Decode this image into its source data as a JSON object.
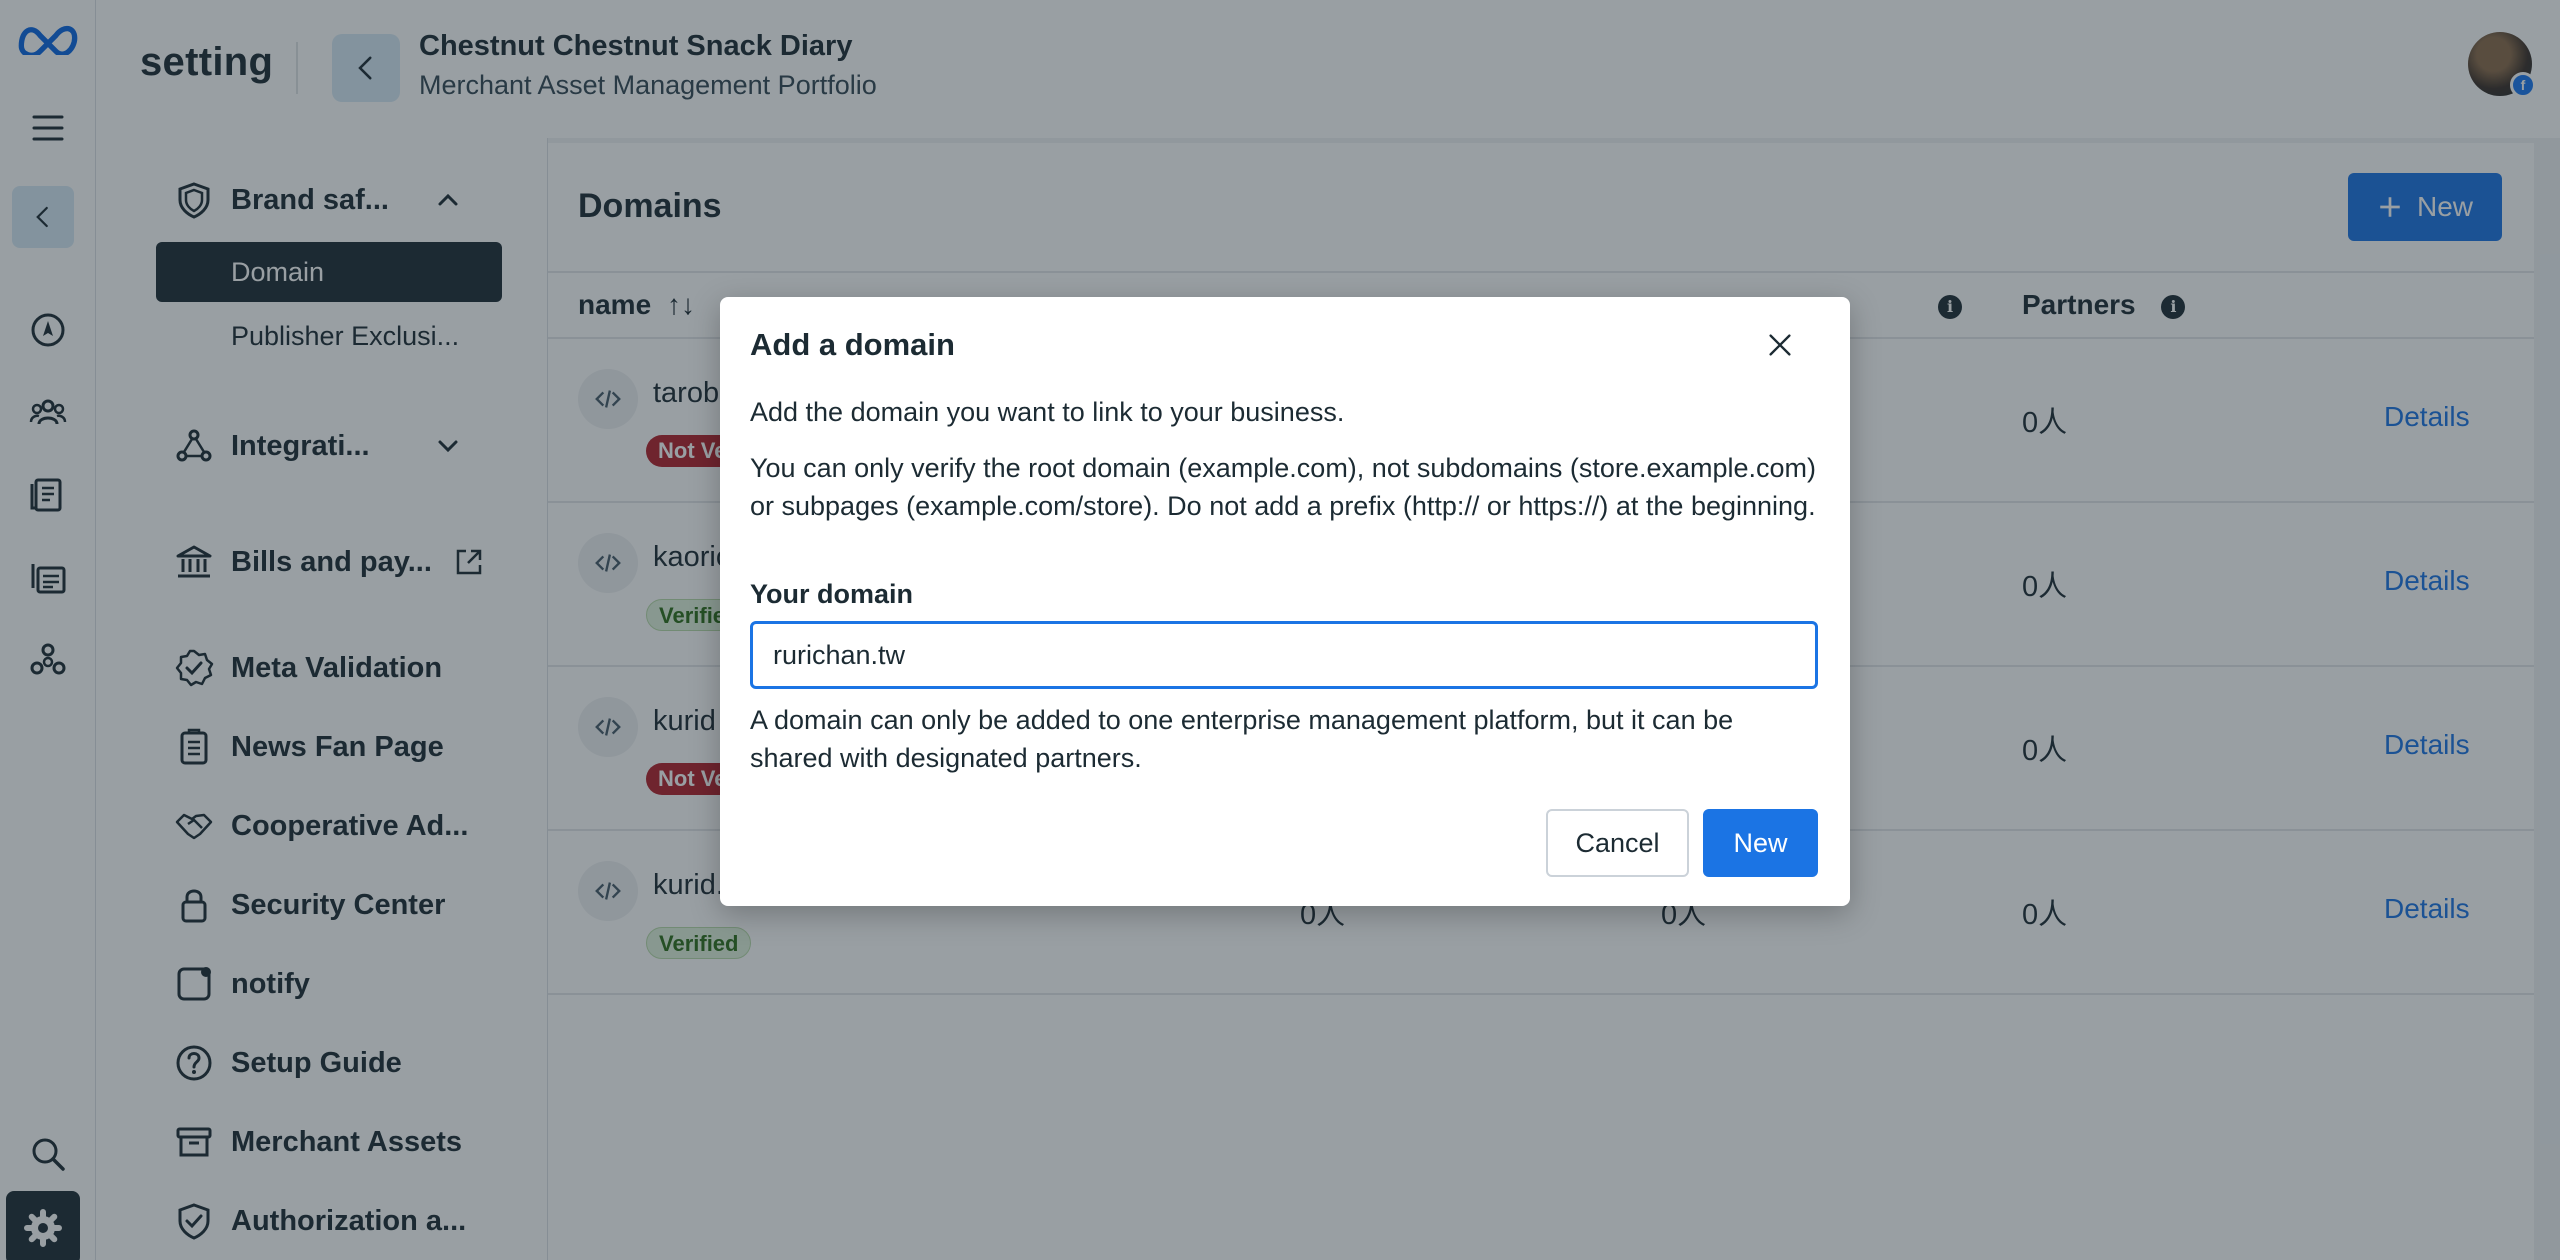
{
  "header": {
    "app_title": "setting",
    "business_name": "Chestnut Chestnut Snack Diary",
    "portfolio_label": "Merchant Asset Management Portfolio"
  },
  "sidebar": {
    "items": [
      {
        "label": "Brand saf...",
        "icon": "shield-icon"
      },
      {
        "label": "Integrati...",
        "icon": "integrations-icon"
      },
      {
        "label": "Bills and pay...",
        "icon": "bank-icon"
      },
      {
        "label": "Meta Validation",
        "icon": "verified-badge-icon"
      },
      {
        "label": "News Fan Page",
        "icon": "news-page-icon"
      },
      {
        "label": "Cooperative Ad...",
        "icon": "handshake-icon"
      },
      {
        "label": "Security Center",
        "icon": "lock-icon"
      },
      {
        "label": "notify",
        "icon": "notification-icon"
      },
      {
        "label": "Setup Guide",
        "icon": "question-circle-icon"
      },
      {
        "label": "Merchant Assets",
        "icon": "archive-box-icon"
      },
      {
        "label": "Authorization a...",
        "icon": "shield-check-icon"
      }
    ],
    "sub_items": [
      {
        "label": "Domain",
        "selected": true
      },
      {
        "label": "Publisher Exclusi...",
        "selected": false
      }
    ]
  },
  "main": {
    "title": "Domains",
    "new_button": "New",
    "columns": [
      {
        "label": "name"
      },
      {
        "label": "Partners"
      }
    ],
    "rows": [
      {
        "name": "tarob",
        "badge": "Not Ve",
        "status": "not-verified",
        "col1": "",
        "col2": "",
        "partners": "0人",
        "action": "Details"
      },
      {
        "name": "kaoric",
        "badge": "Verifie",
        "status": "verified",
        "col1": "",
        "col2": "",
        "partners": "0人",
        "action": "Details"
      },
      {
        "name": "kurid",
        "badge": "Not Ve",
        "status": "not-verified",
        "col1": "",
        "col2": "",
        "partners": "0人",
        "action": "Details"
      },
      {
        "name": "kurid.",
        "badge": "Verified",
        "status": "verified",
        "col1": "0人",
        "col2": "0人",
        "partners": "0人",
        "action": "Details"
      }
    ]
  },
  "modal": {
    "title": "Add a domain",
    "intro": "Add the domain you want to link to your business.",
    "instructions": "You can only verify the root domain (example.com), not subdomains (store.example.com) or subpages (example.com/store). Do not add a prefix (http:// or https://) at the beginning.",
    "field_label": "Your domain",
    "field_value": "rurichan.tw",
    "note": "A domain can only be added to one enterprise management platform, but it can be shared with designated partners.",
    "cancel_label": "Cancel",
    "confirm_label": "New"
  },
  "colors": {
    "accent": "#1b74e4",
    "dark": "#1c2b33",
    "not_verified": "#b3202a",
    "verified_bg": "#e1f2dc"
  }
}
